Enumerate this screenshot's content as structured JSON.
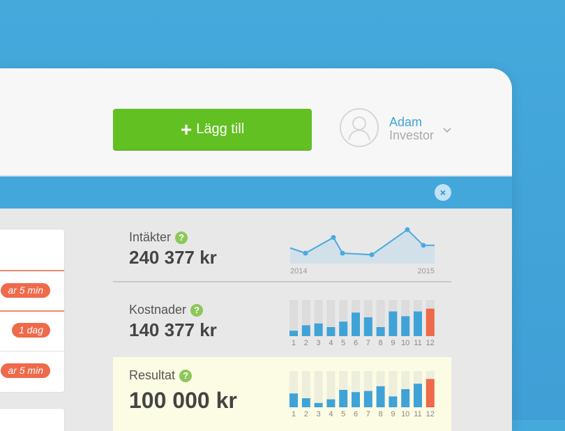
{
  "header": {
    "add_button_icon": "plus-icon",
    "add_button_label": "Lägg till",
    "user": {
      "name": "Adam",
      "role": "Investor",
      "avatar_icon": "user-icon"
    }
  },
  "toolbar": {
    "close_icon": "close-icon",
    "close_label": "×"
  },
  "list": {
    "badges": [
      "ar 5 min",
      "1 dag",
      "ar 5 min"
    ],
    "badge_color": "#ee6a4a"
  },
  "stats": {
    "revenue": {
      "label": "Intäkter",
      "value": "240 377 kr",
      "help": "?"
    },
    "costs": {
      "label": "Kostnader",
      "value": "140 377 kr",
      "help": "?"
    },
    "result": {
      "label": "Resultat",
      "value": "100 000 kr",
      "help": "?"
    }
  },
  "colors": {
    "background": "#43a7dc",
    "add_button": "#62c022",
    "accent_blue": "#3fa3d8",
    "bar_current": "#ee6a4a",
    "help": "#8cc75a"
  },
  "chart_data": [
    {
      "type": "area",
      "x": [
        "2014",
        "",
        "",
        "",
        "",
        "",
        "",
        "2015"
      ],
      "x_tick_labels": [
        "2014",
        "2015"
      ],
      "values": [
        3,
        2,
        5,
        2,
        1.7,
        6.5,
        3.5,
        3.5
      ],
      "ylim": [
        0,
        8
      ],
      "color": "#4aaae0"
    },
    {
      "type": "bar",
      "categories": [
        "1",
        "2",
        "3",
        "4",
        "5",
        "6",
        "7",
        "8",
        "9",
        "10",
        "11",
        "12"
      ],
      "values": [
        15,
        30,
        35,
        25,
        40,
        65,
        52,
        25,
        68,
        55,
        68,
        76
      ],
      "ylim": [
        0,
        100
      ],
      "colors": [
        "#3fa3d8",
        "#3fa3d8",
        "#3fa3d8",
        "#3fa3d8",
        "#3fa3d8",
        "#3fa3d8",
        "#3fa3d8",
        "#3fa3d8",
        "#3fa3d8",
        "#3fa3d8",
        "#3fa3d8",
        "#ee6a4a"
      ],
      "background": "#dcdcdc"
    },
    {
      "type": "bar",
      "categories": [
        "1",
        "2",
        "3",
        "4",
        "5",
        "6",
        "7",
        "8",
        "9",
        "10",
        "11",
        "12"
      ],
      "values": [
        38,
        25,
        12,
        22,
        48,
        42,
        45,
        58,
        30,
        50,
        65,
        78
      ],
      "ylim": [
        0,
        100
      ],
      "colors": [
        "#3fa3d8",
        "#3fa3d8",
        "#3fa3d8",
        "#3fa3d8",
        "#3fa3d8",
        "#3fa3d8",
        "#3fa3d8",
        "#3fa3d8",
        "#3fa3d8",
        "#3fa3d8",
        "#3fa3d8",
        "#ee6a4a"
      ],
      "background": "#eeeedd"
    }
  ]
}
